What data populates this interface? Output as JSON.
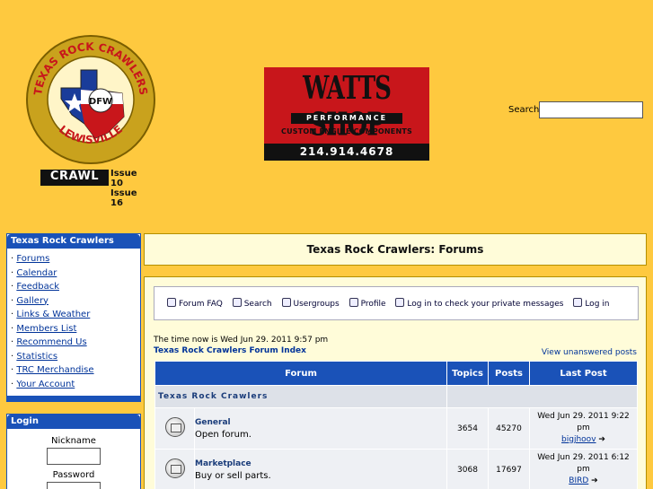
{
  "header": {
    "logo_text_top": "TEXAS ROCK CRAWLERS",
    "logo_text_bottom": "LEWISVILLE",
    "logo_badge": "DFW",
    "crawl_logo": "CRAWL",
    "crawl_issues": [
      "Issue 10",
      "Issue 16"
    ],
    "ad": {
      "title": "WATTS SHOP",
      "subtitle": "PERFORMANCE",
      "tagline": "CUSTOM ENGINE COMPONENTS",
      "phone": "214.914.4678"
    },
    "search_label": "Search",
    "search_value": ""
  },
  "sidebar": {
    "nav_title": "Texas Rock Crawlers",
    "nav_items": [
      {
        "label": "Forums"
      },
      {
        "label": "Calendar"
      },
      {
        "label": "Feedback"
      },
      {
        "label": "Gallery"
      },
      {
        "label": "Links & Weather"
      },
      {
        "label": "Members List"
      },
      {
        "label": "Recommend Us"
      },
      {
        "label": "Statistics"
      },
      {
        "label": "TRC Merchandise"
      },
      {
        "label": "Your Account"
      }
    ],
    "login": {
      "title": "Login",
      "nickname_label": "Nickname",
      "password_label": "Password"
    }
  },
  "main": {
    "page_title": "Texas Rock Crawlers: Forums",
    "nav": {
      "faq": "Forum FAQ",
      "search": "Search",
      "usergroups": "Usergroups",
      "profile": "Profile",
      "messages": "Log in to check your private messages",
      "login": "Log in"
    },
    "time_now": "The time now is Wed Jun 29. 2011 9:57 pm",
    "index_link": "Texas Rock Crawlers Forum Index",
    "unanswered": "View unanswered posts",
    "table": {
      "headers": [
        "Forum",
        "Topics",
        "Posts",
        "Last Post"
      ],
      "category": "Texas Rock Crawlers",
      "rows": [
        {
          "name": "General",
          "desc": "Open forum.",
          "topics": "3654",
          "posts": "45270",
          "last_date": "Wed Jun 29. 2011 9:22 pm",
          "last_user": "bigjhoov"
        },
        {
          "name": "Marketplace",
          "desc": "Buy or sell parts.",
          "topics": "3068",
          "posts": "17697",
          "last_date": "Wed Jun 29. 2011 6:12 pm",
          "last_user": "BIRD"
        }
      ]
    }
  },
  "colors": {
    "page_bg": "#fec93f",
    "panel_blue": "#1a52b8",
    "content_bg": "#fffcd9",
    "ad_red": "#c8161b"
  }
}
